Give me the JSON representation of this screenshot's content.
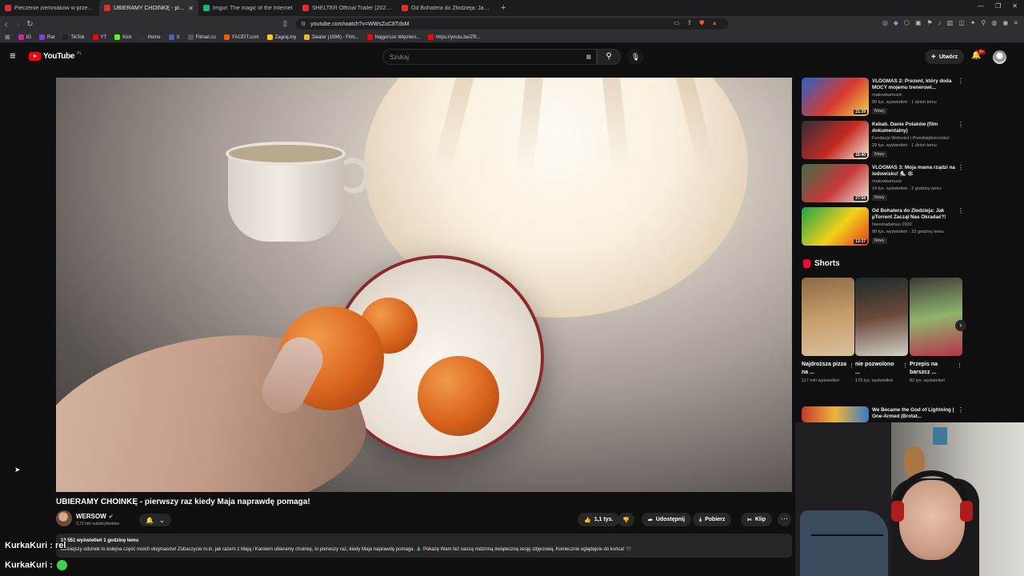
{
  "browser": {
    "tabs": [
      {
        "title": "Pieczenie ziemniaków w przewróconym",
        "color": "#e52d27",
        "active": false
      },
      {
        "title": "UBIERAMY CHOINKĘ - pierwszy raz",
        "color": "#e52d27",
        "active": true
      },
      {
        "title": "Imgur: The magic of the Internet",
        "color": "#1bb76e",
        "active": false
      },
      {
        "title": "SHELTER Official Trailer (2026) Jason",
        "color": "#e52d27",
        "active": false
      },
      {
        "title": "Od Bohatera do Złodzieja: Jak µTorrent",
        "color": "#e52d27",
        "active": false
      }
    ],
    "url": "youtube.com/watch?v=WWsZoC8TdsM",
    "bookmarks": [
      {
        "label": "IG",
        "color": "#d6249f"
      },
      {
        "label": "Rat",
        "color": "#7b3fe4"
      },
      {
        "label": "TikTok",
        "color": "#222222"
      },
      {
        "label": "YT",
        "color": "#ff0000"
      },
      {
        "label": "Kick",
        "color": "#53fc18"
      },
      {
        "label": "Home",
        "color": "#333333"
      },
      {
        "label": "X",
        "color": "#3d6ab3"
      },
      {
        "label": "Filman.cc",
        "color": "#555555"
      },
      {
        "label": "FACEIT.com",
        "color": "#ff5500"
      },
      {
        "label": "Zagraj.my",
        "color": "#ffcc00"
      },
      {
        "label": "Dealer (1996) - Film...",
        "color": "#e8b923"
      },
      {
        "label": "Najgorsze Więzieni...",
        "color": "#ff0000"
      },
      {
        "label": "https://youtu.be/ZR...",
        "color": "#ff0000"
      }
    ]
  },
  "header": {
    "logo_text": "YouTube",
    "region": "PL",
    "search_placeholder": "Szukaj",
    "create_label": "Utwórz",
    "notif_count": "9+"
  },
  "video": {
    "title": "UBIERAMY CHOINKĘ - pierwszy raz kiedy Maja naprawdę pomaga!",
    "channel": "WERSOW",
    "subscribers": "2,72 mln subskrybentów",
    "likes": "1,1 tys.",
    "share_label": "Udostępnij",
    "download_label": "Pobierz",
    "clip_label": "Klip",
    "views_time": "13 551 wyświetleń  1 godzinę temu",
    "description": "Dzisiejszy odcinek to kolejna część moich vlogmasów! Zobaczycie m.in. jak razem z Mają i Karolem ubieramy choinkę, to pierwszy raz, kiedy Maja naprawdę pomaga. 🎄 Pokażę Wam też naszą rodzinną świąteczną sesję zdjęciową. Koniecznie oglądajcie do końca! 🖤"
  },
  "recommendations": [
    {
      "title": "VLOGMAS 2: Prezent, który doda MOCY mojemu trenerowi...",
      "channel": "makowkamusic",
      "views": "90 tys. wyświetleń · 1 dzień temu",
      "badge": "Nowy",
      "duration": "21:39",
      "thumb": [
        "#2b62c9",
        "#d83a2e",
        "#f0d24a"
      ]
    },
    {
      "title": "Kebab. Danie Polaków (film dokumentalny)",
      "channel": "Fundacja Wolności i Przedsiębiorczości",
      "views": "29 tys. wyświetleń · 1 dzień temu",
      "badge": "Nowy",
      "duration": "16:40",
      "thumb": [
        "#2d2f3a",
        "#c52a22",
        "#f2e6d6"
      ]
    },
    {
      "title": "VLOGMAS 3: Moja mama rządzi na lodowisku! ⛸️ ❄️",
      "channel": "makowkamusic",
      "views": "14 tys. wyświetleń · 2 godziny temu",
      "badge": "Nowy",
      "duration": "27:58",
      "thumb": [
        "#3e6f45",
        "#c7383a",
        "#e8e2d3"
      ]
    },
    {
      "title": "Od Bohatera do Złodzieja: Jak µTorrent Zaczął Nas Okradać?!",
      "channel": "Neostradamus 2000",
      "views": "98 tys. wyświetleń · 23 godziny temu",
      "badge": "Nowy",
      "duration": "13:37",
      "thumb": [
        "#1aa34a",
        "#f2d21a",
        "#e23a1d"
      ]
    }
  ],
  "shorts": {
    "heading": "Shorts",
    "items": [
      {
        "title": "Najdroższa pizza na ...",
        "views": "117 mln wyświetleń",
        "thumb": [
          "#8b6a46",
          "#c69d6b",
          "#d9c19a"
        ]
      },
      {
        "title": "nie pozwolono ...",
        "views": "170 tys. wyświetleń",
        "thumb": [
          "#1e2b2a",
          "#6b4a3a",
          "#d2d0c8"
        ]
      },
      {
        "title": "Przepis na barszcz ...",
        "views": "82 tys. wyświetleń",
        "thumb": [
          "#3e3a36",
          "#8fb46d",
          "#b8334a"
        ]
      }
    ]
  },
  "last_rec": {
    "title": "We Became the God of Lightning | One-Armed (Brotat..."
  },
  "chat": [
    {
      "user": "KurkaKuri",
      "msg": "rel"
    },
    {
      "user": "KurkaKuri",
      "msg": ""
    }
  ]
}
